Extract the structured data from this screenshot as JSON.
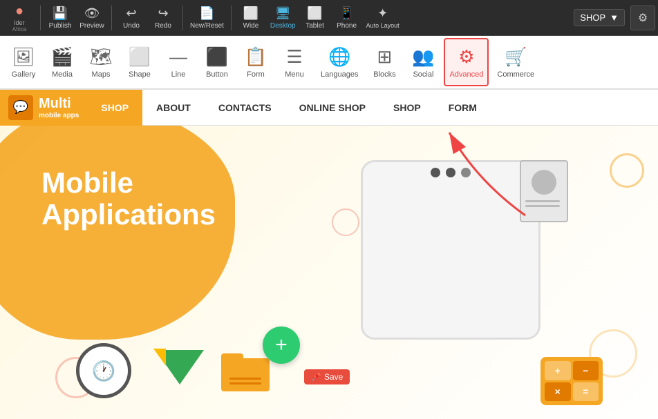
{
  "toolbar": {
    "brand": "lder",
    "brand_sub": "Africa",
    "publish_label": "Publish",
    "preview_label": "Preview",
    "undo_label": "Undo",
    "redo_label": "Redo",
    "new_reset_label": "New/Reset",
    "wide_label": "Wide",
    "desktop_label": "Desktop",
    "tablet_label": "Tablet",
    "phone_label": "Phone",
    "auto_layout_label": "Auto Layout",
    "shop_dropdown": "SHOP",
    "gear_label": "Settings"
  },
  "second_toolbar": {
    "items": [
      {
        "icon": "🖼",
        "label": "Gallery"
      },
      {
        "icon": "🎬",
        "label": "Media"
      },
      {
        "icon": "🗺",
        "label": "Maps"
      },
      {
        "icon": "⬜",
        "label": "Shape"
      },
      {
        "icon": "—",
        "label": "Line"
      },
      {
        "icon": "⬛",
        "label": "Button"
      },
      {
        "icon": "📋",
        "label": "Form"
      },
      {
        "icon": "☰",
        "label": "Menu"
      },
      {
        "icon": "🌐",
        "label": "Languages"
      },
      {
        "icon": "⊞",
        "label": "Blocks"
      },
      {
        "icon": "👥",
        "label": "Social"
      },
      {
        "icon": "⚙",
        "label": "Advanced"
      },
      {
        "icon": "🛒",
        "label": "Commerce"
      }
    ]
  },
  "site_nav": {
    "logo_main": "Multi",
    "logo_sub": "mobile apps",
    "shop_tab": "SHOP",
    "nav_links": [
      {
        "label": "ABOUT"
      },
      {
        "label": "CONTACTS"
      },
      {
        "label": "ONLINE SHOP"
      },
      {
        "label": "SHOP"
      },
      {
        "label": "FORM"
      }
    ]
  },
  "hero": {
    "title_line1": "Mobile",
    "title_line2": "Applications"
  },
  "save_badge": {
    "icon": "📌",
    "label": "Save"
  },
  "colors": {
    "orange": "#f5a623",
    "green": "#2ecc71",
    "red": "#e74c3c",
    "dark": "#2c2c2c"
  }
}
